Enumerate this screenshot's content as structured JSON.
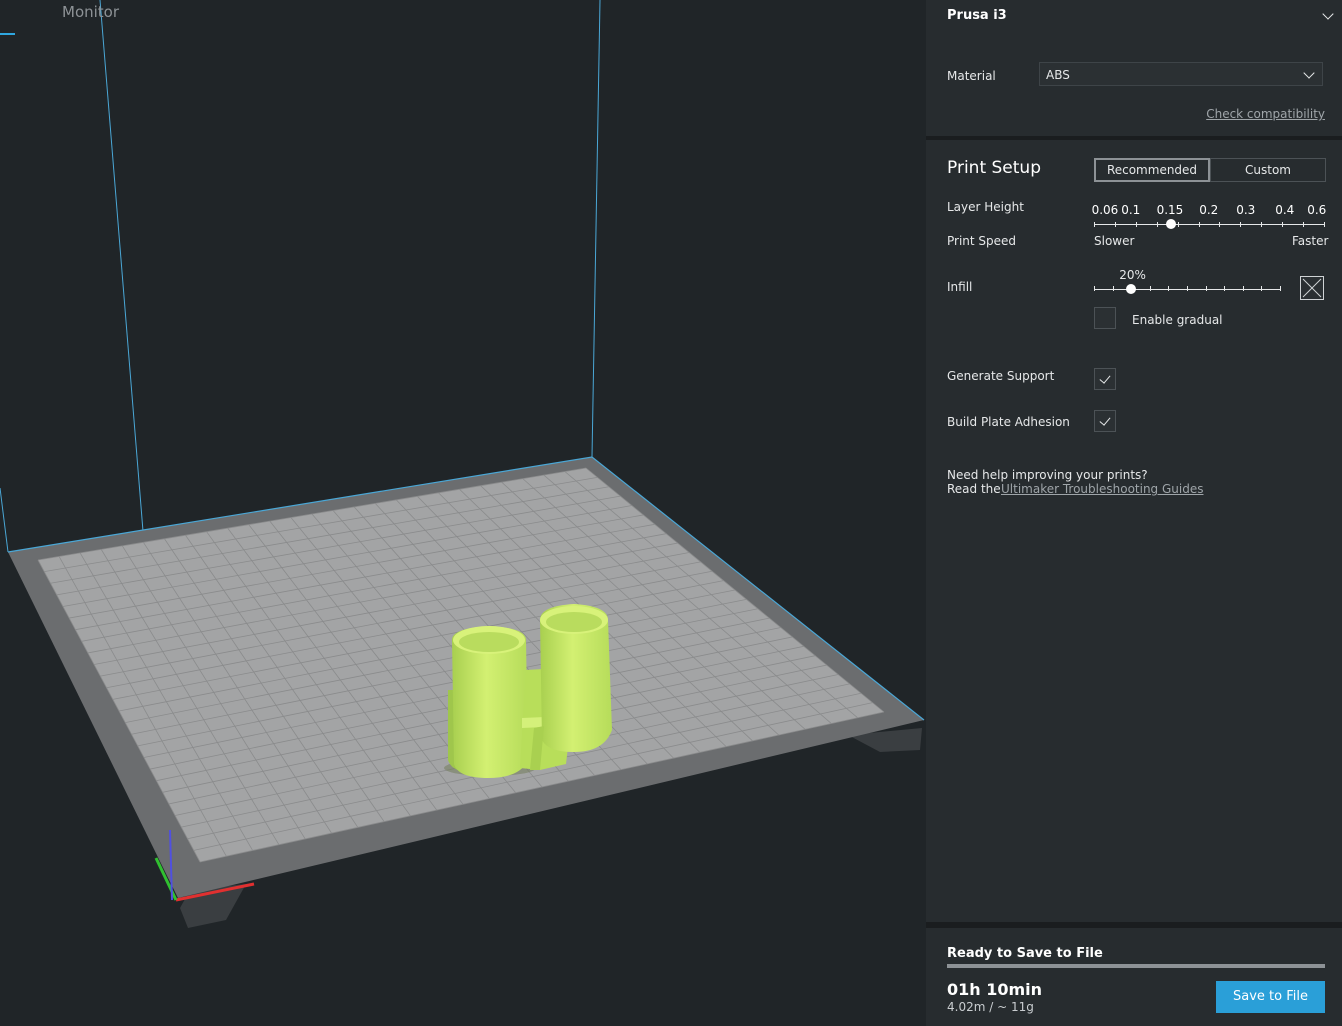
{
  "stage": {
    "tab_label": "Monitor"
  },
  "printer": {
    "name": "Prusa i3",
    "expand_icon": "chevron-down-icon"
  },
  "material": {
    "label": "Material",
    "value": "ABS",
    "check_link": "Check compatibility"
  },
  "print_setup": {
    "title": "Print Setup",
    "modes": [
      "Recommended",
      "Custom"
    ],
    "active_mode": "Recommended",
    "layer_height": {
      "label": "Layer Height",
      "values": [
        "0.06",
        "0.1",
        "0.15",
        "0.2",
        "0.3",
        "0.4",
        "0.6"
      ],
      "selected": "0.15"
    },
    "print_speed": {
      "label": "Print Speed",
      "slower": "Slower",
      "faster": "Faster"
    },
    "infill": {
      "label": "Infill",
      "value": "20%",
      "percent": 20,
      "pattern_icon": "infill-pattern-icon"
    },
    "gradual": {
      "label": "Enable gradual",
      "checked": false
    },
    "support": {
      "label": "Generate Support",
      "checked": true
    },
    "adhesion": {
      "label": "Build Plate Adhesion",
      "checked": true
    },
    "help": {
      "line1": "Need help improving your prints?",
      "read_prefix": "Read the",
      "link": "Ultimaker Troubleshooting Guides"
    }
  },
  "output": {
    "status": "Ready to Save to File",
    "progress": 1.0,
    "time": "01h 10min",
    "usage": "4.02m / ~ 11g",
    "save_button": "Save to File"
  },
  "colors": {
    "accent": "#2a9fd8",
    "model": "#c6e86a",
    "sidebar_bg": "#272c2f",
    "viewport_bg": "#202528"
  }
}
